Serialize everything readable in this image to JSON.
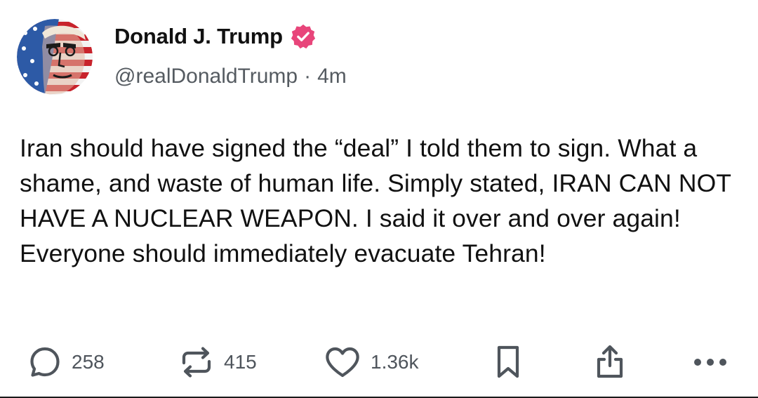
{
  "post": {
    "author": {
      "display_name": "Donald J. Trump",
      "handle": "@realDonaldTrump",
      "verified": true,
      "avatar_icon": "flag-portrait-avatar"
    },
    "separator": "·",
    "time_ago": "4m",
    "text": "Iran should have signed the “deal” I told them to sign. What a shame, and waste of human life. Simply stated, IRAN CAN NOT HAVE A NUCLEAR WEAPON. I said it over and over again! Everyone should immediately evacuate Tehran!"
  },
  "actions": {
    "reply": {
      "icon": "reply-bubble-icon",
      "count": "258"
    },
    "repost": {
      "icon": "repost-icon",
      "count": "415"
    },
    "like": {
      "icon": "heart-icon",
      "count": "1.36k"
    },
    "bookmark": {
      "icon": "bookmark-icon"
    },
    "share": {
      "icon": "share-icon"
    },
    "more": {
      "icon": "more-dots-icon"
    }
  },
  "colors": {
    "verified_badge": "#e8457a",
    "text": "#111111",
    "muted": "#555b61",
    "icon": "#4f555c"
  }
}
